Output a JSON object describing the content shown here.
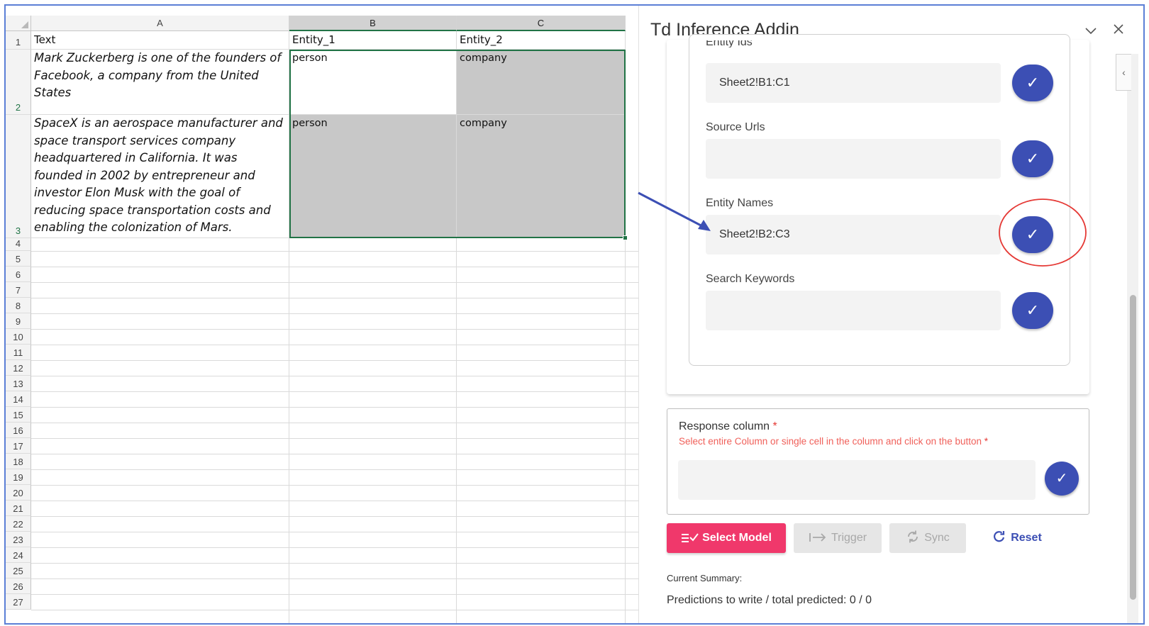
{
  "sheet": {
    "columns": [
      "A",
      "B",
      "C"
    ],
    "rows": [
      "1",
      "2",
      "3",
      "4",
      "5",
      "6",
      "7",
      "8",
      "9",
      "10",
      "11",
      "12",
      "13",
      "14",
      "15",
      "16",
      "17",
      "18",
      "19",
      "20",
      "21",
      "22",
      "23",
      "24",
      "25",
      "26",
      "27"
    ],
    "header": {
      "a": "Text",
      "b": "Entity_1",
      "c": "Entity_2"
    },
    "row2": {
      "a": "Mark Zuckerberg is one of the founders of Facebook, a company from the United States",
      "b": "person",
      "c": "company"
    },
    "row3": {
      "a": "SpaceX is an aerospace manufacturer and space transport services company headquartered in California. It was founded in 2002 by entrepreneur and investor Elon Musk with the goal of reducing space transportation costs and enabling the colonization of Mars.",
      "b": "person",
      "c": "company"
    }
  },
  "pane": {
    "title": "Td Inference Addin",
    "chevron_icon": "chevron-down-icon",
    "close_icon": "close-icon",
    "side_tab_glyph": "‹",
    "fields": {
      "entity_ids": {
        "label": "Entity Ids",
        "value": "Sheet2!B1:C1"
      },
      "source_urls": {
        "label": "Source Urls",
        "value": ""
      },
      "entity_names": {
        "label": "Entity Names",
        "value": "Sheet2!B2:C3"
      },
      "search_keywords": {
        "label": "Search Keywords",
        "value": ""
      }
    },
    "check_glyph": "✓",
    "response": {
      "label": "Response column",
      "required_mark": "*",
      "hint": "Select entire Column or single cell in the column and click on the button",
      "value": ""
    },
    "buttons": {
      "select_model": "Select Model",
      "trigger": "Trigger",
      "sync": "Sync",
      "reset": "Reset"
    },
    "summary_label": "Current Summary:",
    "summary_value": "Predictions to write / total predicted: 0 / 0"
  },
  "colors": {
    "accent": "#3c4fb4",
    "select_model": "#f0386b",
    "selection_border": "#217346",
    "annotation_arrow": "#3c4fb4",
    "annotation_circle": "#e53935"
  }
}
